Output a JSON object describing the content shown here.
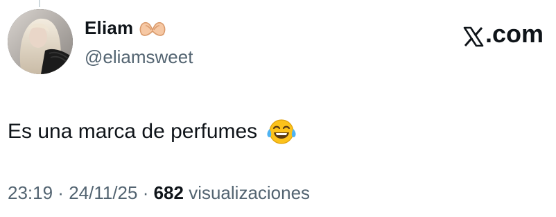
{
  "author": {
    "display_name": "Eliam",
    "handle": "@eliamsweet",
    "name_emoji_icon": "heart-hands-icon"
  },
  "brand": {
    "label": ".com",
    "logo_icon": "x-logo-icon"
  },
  "tweet": {
    "text": "Es una marca de perfumes",
    "emoji_icon": "face-with-tears-of-joy-icon"
  },
  "meta": {
    "time": "23:19",
    "separator1": " · ",
    "date": "24/11/25",
    "separator2": " · ",
    "views_count": "682",
    "views_label": " visualizaciones"
  },
  "colors": {
    "text_primary": "#0f1419",
    "text_secondary": "#536471",
    "background": "#ffffff"
  }
}
